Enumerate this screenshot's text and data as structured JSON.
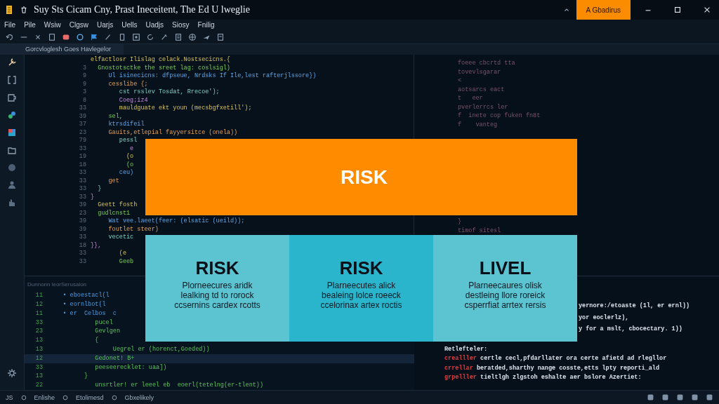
{
  "window": {
    "title": "Suy Sts Cicam Cny, Prast Ineceitent, The Ed U lweglie",
    "account_button": "A Gbadirus"
  },
  "menu": [
    "File",
    "Pile",
    "Wsiw",
    "Clgsw",
    "Uarjs",
    "Uells",
    "Uadjs",
    "Siosy",
    "Fnilig"
  ],
  "tab": {
    "label": "Gorcvloglesh Goes Havlegelor"
  },
  "editor": {
    "lines": [
      {
        "text": "elfactlosr Ilislag celack.Nostsecicns.{"
      },
      {
        "number": "3",
        "text": "  Gnostotsctke the sreet lag: coslsigl)"
      },
      {
        "number": "9",
        "text": "     Ul isinecicns: dfpseue, Nrdsks If Ile,lest rafterjlssore})"
      },
      {
        "number": "9",
        "text": "     cesslibe {;"
      },
      {
        "number": "3",
        "text": "        cst rsslev Tosdat, Rrecoe');"
      },
      {
        "number": "8",
        "text": "        Coeg;iz4"
      },
      {
        "number": "33",
        "text": "        mauldguate ekt youn (mecsbgfxetill');"
      },
      {
        "number": "39",
        "text": "     sel,"
      },
      {
        "number": "37",
        "text": "     ktrsdifeil"
      },
      {
        "number": "23",
        "text": "     Gauits,etlepial fayyersitce (onela))"
      },
      {
        "number": "79",
        "text": "        pessl"
      },
      {
        "number": "33",
        "text": "           e"
      },
      {
        "number": "19",
        "text": "          (o"
      },
      {
        "number": "18",
        "text": "          (o"
      },
      {
        "number": "33",
        "text": "        ceu)"
      },
      {
        "number": "33",
        "text": "     get"
      },
      {
        "number": "33",
        "text": "  }"
      },
      {
        "number": "33",
        "text": "}"
      },
      {
        "number": "39",
        "text": "  Geett fosth"
      },
      {
        "number": "23",
        "text": "  gudlcnst1"
      },
      {
        "number": "39",
        "text": "     Wat vee.laeet(feer: (elsatic (ueild));"
      },
      {
        "number": "39",
        "text": "     foutlet steer)"
      },
      {
        "number": "33",
        "text": "     vecetic"
      },
      {
        "number": "18",
        "text": "}},"
      },
      {
        "number": "33",
        "text": "        (e"
      },
      {
        "number": "33",
        "text": "        Geeb"
      }
    ]
  },
  "side_pane": {
    "lines_top": [
      "foeee cbcrtd tta",
      "tovevlsgarar",
      "<",
      "aotsarcs eact",
      "t   eer",
      "pverlerrcs ler",
      "f  inete cop fuken fn8t",
      "f    vanteg"
    ],
    "lines_bottom": [
      "}",
      "timof sitesl"
    ]
  },
  "panel": {
    "title": "Dunnonn leorSerusaion",
    "lines": [
      {
        "number": "11",
        "text": "    • eboestacl(l",
        "current": false
      },
      {
        "number": "12",
        "text": "    • eornlbot(l",
        "current": false
      },
      {
        "number": "11",
        "text": "    • er  Celbos  c",
        "current": false
      },
      {
        "number": "33",
        "text": "             pucel",
        "current": false
      },
      {
        "number": "23",
        "text": "             Gevlgen",
        "current": false
      },
      {
        "number": "13",
        "text": "             {",
        "current": false
      },
      {
        "number": "13",
        "text": "                  Uegrel er (horenct,Goeded))",
        "current": false
      },
      {
        "number": "12",
        "text": "             Gedonet! B+",
        "current": true
      },
      {
        "number": "33",
        "text": "             peeseerecklet: uaa])",
        "current": false
      },
      {
        "number": "13",
        "text": "          }",
        "current": false
      },
      {
        "number": "22",
        "text": "             unsrtler! er leeel eb  eoerl(tetelng(er-tlent))",
        "current": false
      }
    ]
  },
  "terminal": {
    "lines": [
      {
        "kind": "continued",
        "text": "yernore:/etoaste (1l, er ernl))"
      },
      {
        "kind": "continued",
        "text": "yor eoclerlz),"
      },
      {
        "kind": "continued",
        "text": "y for a mslt, cbocectary. 1))"
      },
      {
        "kind": "heading",
        "text": "Retlefteler:"
      },
      {
        "kind": "error",
        "prefix": "crealller",
        "text": "certle cecl,pfdarllater ora certe afietd ad rlegllor"
      },
      {
        "kind": "error",
        "prefix": "crrellar",
        "text": "beratded,sharthy nange cosste,etts lpty reporti_ald"
      },
      {
        "kind": "error",
        "prefix": "grpelller",
        "text": "tieltlgh zlgstoh eshalte aer bslore Azertiet:"
      }
    ]
  },
  "overlay": {
    "banner": "RISK",
    "cards": [
      {
        "title": "RISK",
        "body": "Plorneecures aridk\nlealking td to rorock\nccsernins cardex rcotts",
        "color": "#5cc3d0"
      },
      {
        "title": "RISK",
        "body": "Plarneecutes alick\nbealeing lolce roeeck\nccelorinax artex roctis",
        "color": "#2bb5cc"
      },
      {
        "title": "LIVEL",
        "body": "Plarneecaures olisk\ndestleing llore roreick\ncsperrfiat arrtex rersis",
        "color": "#5cc3d0"
      }
    ]
  },
  "status_bar": {
    "items": [
      "JS",
      "Enlishe",
      "Etolimesd",
      "Gbxelikely"
    ]
  }
}
